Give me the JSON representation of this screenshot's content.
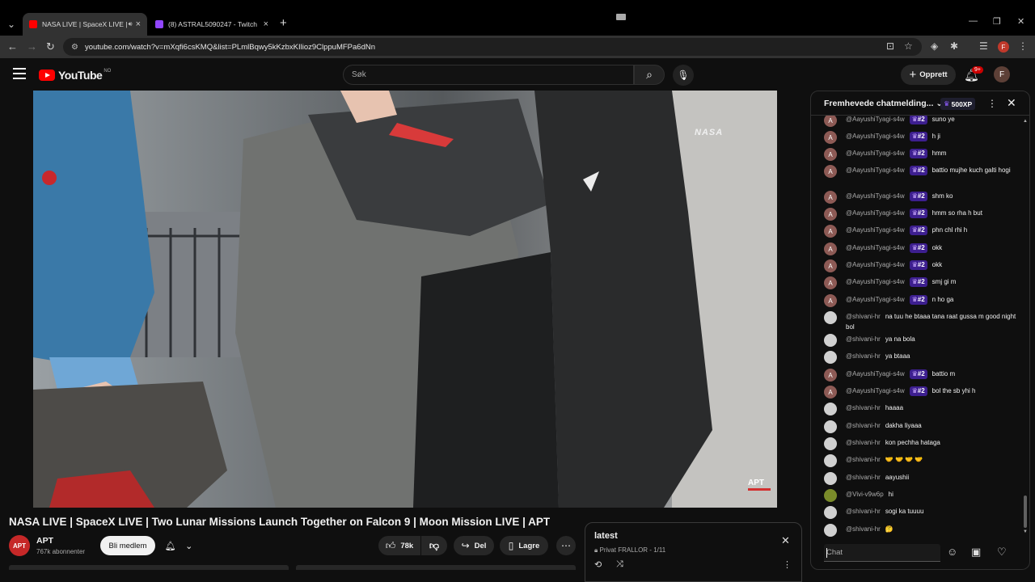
{
  "browser": {
    "tabs": [
      {
        "title": "NASA LIVE | SpaceX LIVE | T",
        "active": true
      },
      {
        "title": "(8) ASTRAL5090247 - Twitch",
        "active": false
      }
    ],
    "url": "youtube.com/watch?v=mXqfi6csKMQ&list=PLmlBqwy5kKzbxKIlioz9ClppuMFPa6dNn",
    "profile_initial": "F"
  },
  "header": {
    "logo_text": "YouTube",
    "country_code": "NO",
    "search_placeholder": "Søk",
    "create_label": "Opprett",
    "notif_count": "9+",
    "avatar_initial": "F"
  },
  "video": {
    "watermark_nasa": "NASA",
    "watermark_channel": "APT",
    "title": "NASA LIVE | SpaceX LIVE | Two Lunar Missions Launch Together on Falcon 9 | Moon Mission LIVE | APT"
  },
  "channel": {
    "avatar_text": "APT",
    "name": "APT",
    "subscribers": "767k abonnenter",
    "join_label": "Bli medlem"
  },
  "actions": {
    "likes": "78k",
    "share_label": "Del",
    "save_label": "Lagre"
  },
  "playlist": {
    "title": "latest",
    "privacy": "Privat",
    "owner_index": "FRALLOR - 1/11"
  },
  "chat": {
    "header_title": "Fremhevede chatmelding...",
    "xp_label": "500XP",
    "input_placeholder": "Chat",
    "messages": [
      {
        "user": "@AayushiTyagi-s4w",
        "badge": "#2",
        "text": "suno ye",
        "av": "A"
      },
      {
        "user": "@AayushiTyagi-s4w",
        "badge": "#2",
        "text": "h ji",
        "av": "A"
      },
      {
        "user": "@AayushiTyagi-s4w",
        "badge": "#2",
        "text": "hmm",
        "av": "A"
      },
      {
        "user": "@AayushiTyagi-s4w",
        "badge": "#2",
        "text": "battio mujhe kuch galti hogi",
        "av": "A"
      },
      {
        "user": "@AayushiTyagi-s4w",
        "badge": "#2",
        "text": "shm ko",
        "av": "A"
      },
      {
        "user": "@AayushiTyagi-s4w",
        "badge": "#2",
        "text": "hmm so rha h but",
        "av": "A"
      },
      {
        "user": "@AayushiTyagi-s4w",
        "badge": "#2",
        "text": "phn chl rhi h",
        "av": "A"
      },
      {
        "user": "@AayushiTyagi-s4w",
        "badge": "#2",
        "text": "okk",
        "av": "A"
      },
      {
        "user": "@AayushiTyagi-s4w",
        "badge": "#2",
        "text": "okk",
        "av": "A"
      },
      {
        "user": "@AayushiTyagi-s4w",
        "badge": "#2",
        "text": "smj gi m",
        "av": "A"
      },
      {
        "user": "@AayushiTyagi-s4w",
        "badge": "#2",
        "text": "n ho ga",
        "av": "A"
      },
      {
        "user": "@shivani-hr",
        "badge": "",
        "text": "na tuu he btaaa tana raat gussa m good night bol",
        "av": ""
      },
      {
        "user": "@shivani-hr",
        "badge": "",
        "text": "ya na bola",
        "av": ""
      },
      {
        "user": "@shivani-hr",
        "badge": "",
        "text": "ya btaaa",
        "av": ""
      },
      {
        "user": "@AayushiTyagi-s4w",
        "badge": "#2",
        "text": "battio m",
        "av": "A"
      },
      {
        "user": "@AayushiTyagi-s4w",
        "badge": "#2",
        "text": "bol the sb yhi h",
        "av": "A"
      },
      {
        "user": "@shivani-hr",
        "badge": "",
        "text": "haaaa",
        "av": ""
      },
      {
        "user": "@shivani-hr",
        "badge": "",
        "text": "dakha liyaaa",
        "av": ""
      },
      {
        "user": "@shivani-hr",
        "badge": "",
        "text": "kon pechha hataga",
        "av": ""
      },
      {
        "user": "@shivani-hr",
        "badge": "",
        "text": "🤝 🤝 🤝 🤝",
        "av": ""
      },
      {
        "user": "@shivani-hr",
        "badge": "",
        "text": "aayushii",
        "av": ""
      },
      {
        "user": "@Vivi-v9w6p",
        "badge": "",
        "text": "hi",
        "av": ""
      },
      {
        "user": "@shivani-hr",
        "badge": "",
        "text": "sogi ka tuuuu",
        "av": ""
      },
      {
        "user": "@shivani-hr",
        "badge": "",
        "text": "🤔",
        "av": ""
      }
    ]
  },
  "colors": {
    "accent_red": "#ff0000",
    "badge_purple": "#3d1f8f",
    "avatar_a": "#8d5a55"
  }
}
